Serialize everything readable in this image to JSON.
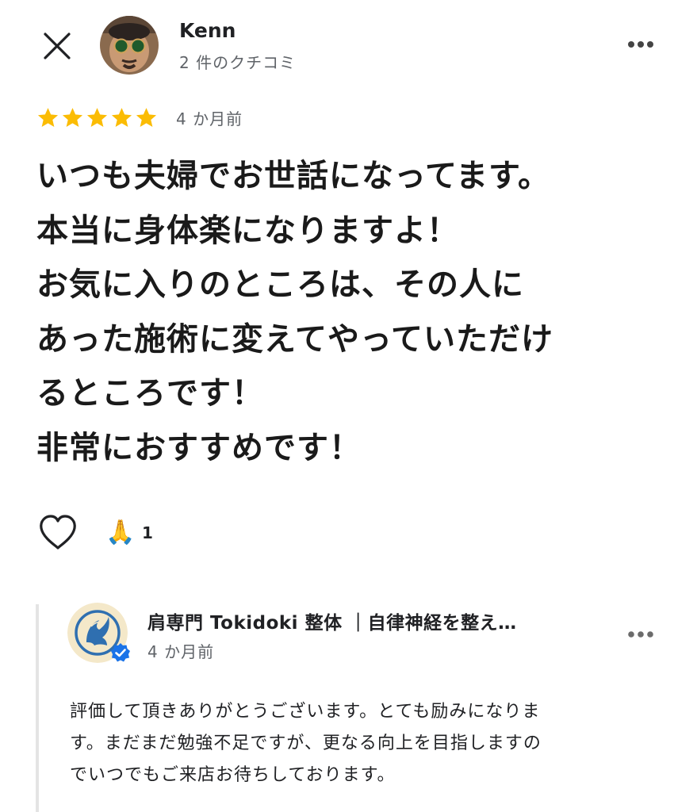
{
  "header": {
    "close_icon": "close-icon",
    "author_name": "Kenn",
    "author_meta": "2 件のクチコミ",
    "more_icon": "more-horizontal-icon"
  },
  "review": {
    "rating": 5,
    "rating_max": 5,
    "star_color": "#fbbc04",
    "date": "4 か月前",
    "text": "いつも夫婦でお世話になってます。\n本当に身体楽になりますよ！\nお気に入りのところは、その人に\nあった施術に変えてやっていただけ\nるところです！\n非常におすすめです！"
  },
  "reactions": {
    "like_icon": "heart-outline-icon",
    "emoji": "🙏",
    "count": "1"
  },
  "owner_reply": {
    "name": "肩専門 Tokidoki 整体 ｜自律神経を整え…",
    "date": "4 か月前",
    "verified_icon": "verified-badge-icon",
    "verified_color": "#1a73e8",
    "more_icon": "more-horizontal-icon",
    "text": "評価して頂きありがとうございます。とても励みになりま\nす。まだまだ勉強不足ですが、更なる向上を目指しますの\nでいつでもご来店お待ちしております。"
  }
}
